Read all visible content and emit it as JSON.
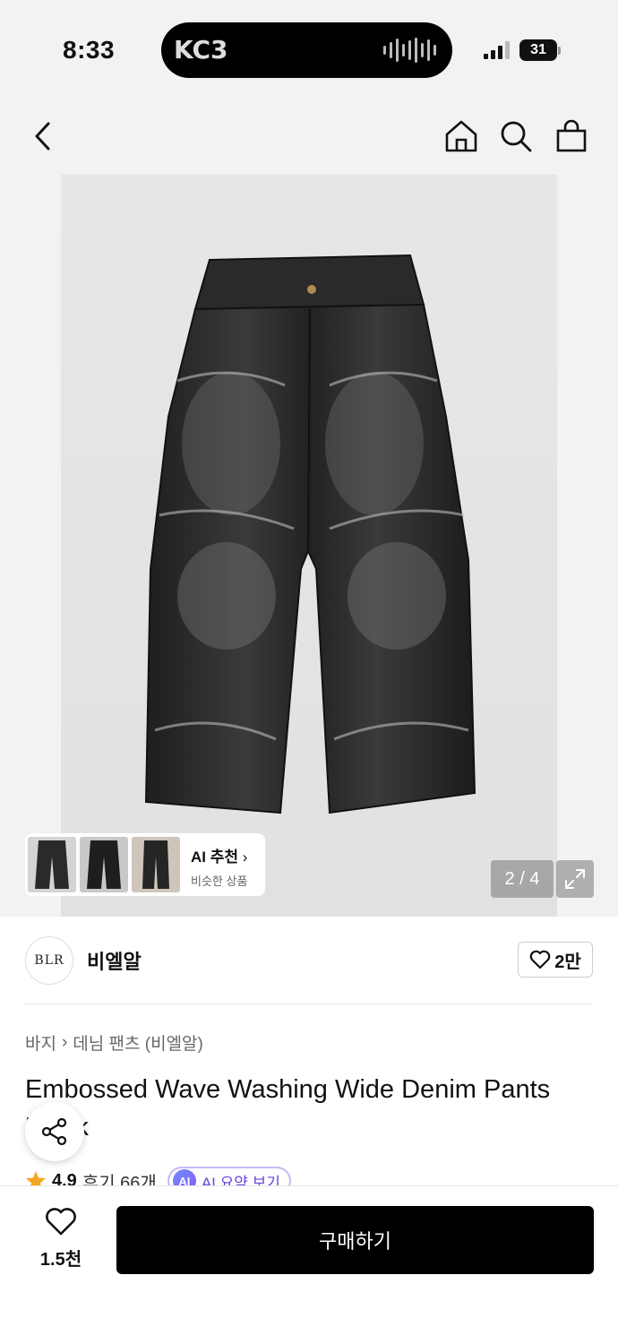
{
  "status_bar": {
    "time": "8:33",
    "battery": "31",
    "island_logo": "KC3"
  },
  "nav": {
    "back_icon": "chevron-left-icon",
    "home_icon": "home-icon",
    "search_icon": "search-icon",
    "bag_icon": "shopping-bag-icon"
  },
  "gallery": {
    "ai_title": "AI 추천",
    "ai_subtitle": "비슷한 상품",
    "pager": "2 / 4",
    "expand_icon": "expand-icon"
  },
  "brand": {
    "logo_text": "BLR",
    "name": "비엘알",
    "likes": "2만"
  },
  "breadcrumb": {
    "level1": "바지",
    "level2": "데님 팬츠 (비엘알)"
  },
  "product": {
    "title_line1": "Embossed Wave Washing Wide Denim Pants",
    "title_line2": "Black"
  },
  "rating": {
    "score": "4.9",
    "reviews": "후기 66개",
    "ai_badge": "AI",
    "ai_summary": "AI 요약 보기"
  },
  "bottom_bar": {
    "wish_count": "1.5천",
    "buy_label": "구매하기"
  },
  "colors": {
    "accent_purple": "#6a46d8",
    "star": "#f5a623",
    "buy_bg": "#000000"
  }
}
